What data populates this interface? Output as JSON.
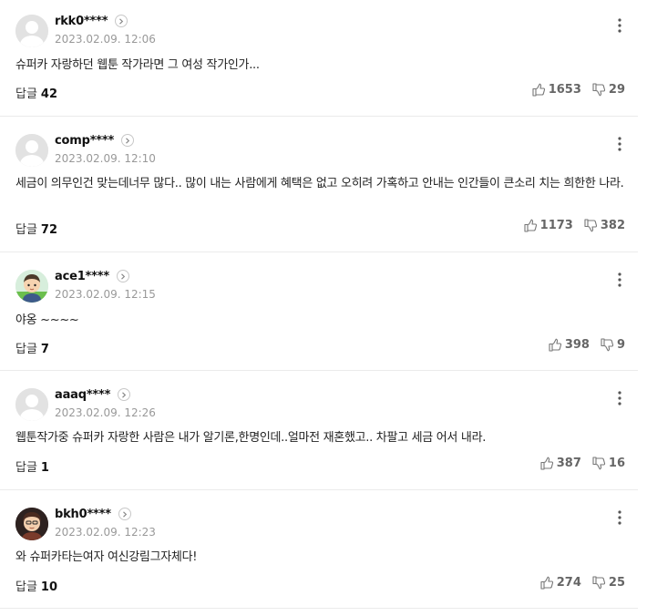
{
  "comments": [
    {
      "nickname": "rkk0****",
      "date": "2023.02.09. 12:06",
      "text": "슈퍼카 자랑하던 웹툰 작가라면 그 여성 작가인가...",
      "reply_label": "답글",
      "reply_count": "42",
      "likes": "1653",
      "dislikes": "29",
      "avatar": "default-avatar"
    },
    {
      "nickname": "comp****",
      "date": "2023.02.09. 12:10",
      "text": "세금이 의무인건 맞는데너무 많다.. 많이 내는 사람에게 혜택은 없고 오히려 가혹하고 안내는 인간들이 큰소리 치는 희한한 나라.",
      "reply_label": "답글",
      "reply_count": "72",
      "likes": "1173",
      "dislikes": "382",
      "avatar": "default-avatar"
    },
    {
      "nickname": "ace1****",
      "date": "2023.02.09. 12:15",
      "text": "야옹 ~~~~",
      "reply_label": "답글",
      "reply_count": "7",
      "likes": "398",
      "dislikes": "9",
      "avatar": "character-avatar-green"
    },
    {
      "nickname": "aaaq****",
      "date": "2023.02.09. 12:26",
      "text": "웹툰작가중 슈퍼카 자랑한 사람은 내가 알기론,한명인데..얼마전 재혼했고.. 차팔고 세금 어서 내라.",
      "reply_label": "답글",
      "reply_count": "1",
      "likes": "387",
      "dislikes": "16",
      "avatar": "default-avatar"
    },
    {
      "nickname": "bkh0****",
      "date": "2023.02.09. 12:23",
      "text": "와 슈퍼카타는여자 여신강림그자체다!",
      "reply_label": "답글",
      "reply_count": "10",
      "likes": "274",
      "dislikes": "25",
      "avatar": "character-avatar-dark"
    }
  ],
  "colors": {
    "text": "#222222",
    "date": "#999999",
    "divider": "#ebebeb",
    "vote": "#666666"
  }
}
